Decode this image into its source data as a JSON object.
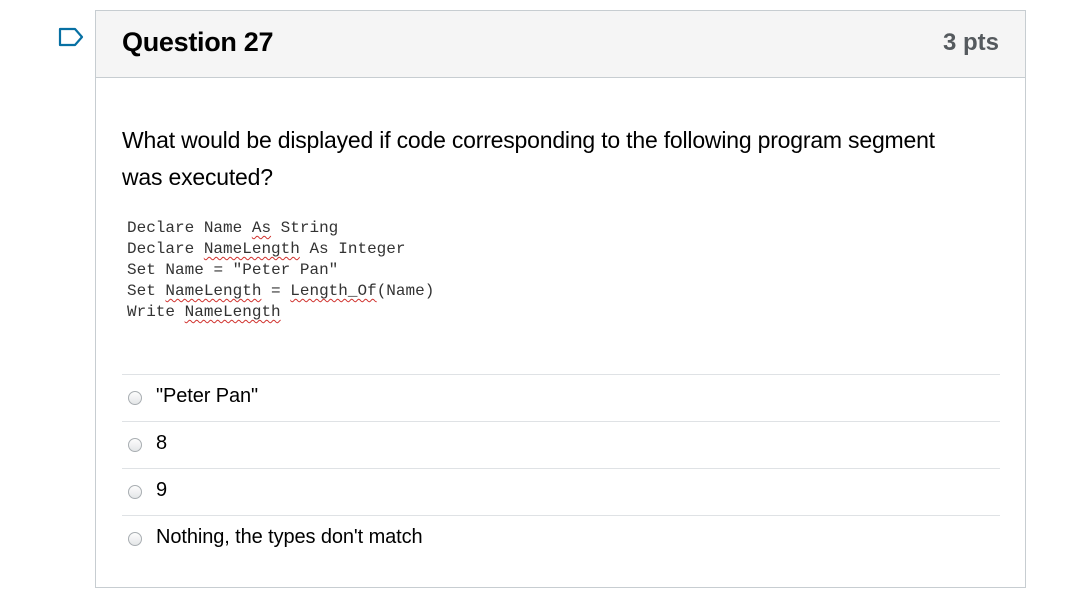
{
  "flag": {
    "icon": "flag-marker-icon",
    "color": "#0770a3"
  },
  "question": {
    "title": "Question 27",
    "points": "3 pts",
    "text": "What would be displayed if code corresponding to the following program segment was executed?",
    "code_lines": [
      "Declare Name As String",
      "Declare NameLength As Integer",
      "Set Name = \"Peter Pan\"",
      "Set NameLength = Length_Of(Name)",
      "Write NameLength"
    ],
    "answers": [
      {
        "label": "\"Peter Pan\"",
        "selected": false
      },
      {
        "label": "8",
        "selected": false
      },
      {
        "label": "9",
        "selected": false
      },
      {
        "label": "Nothing, the types don't match",
        "selected": false
      }
    ]
  },
  "colors": {
    "header_bg": "#f5f5f5",
    "border": "#c7cdd1",
    "spellcheck_underline": "#d0312d"
  }
}
